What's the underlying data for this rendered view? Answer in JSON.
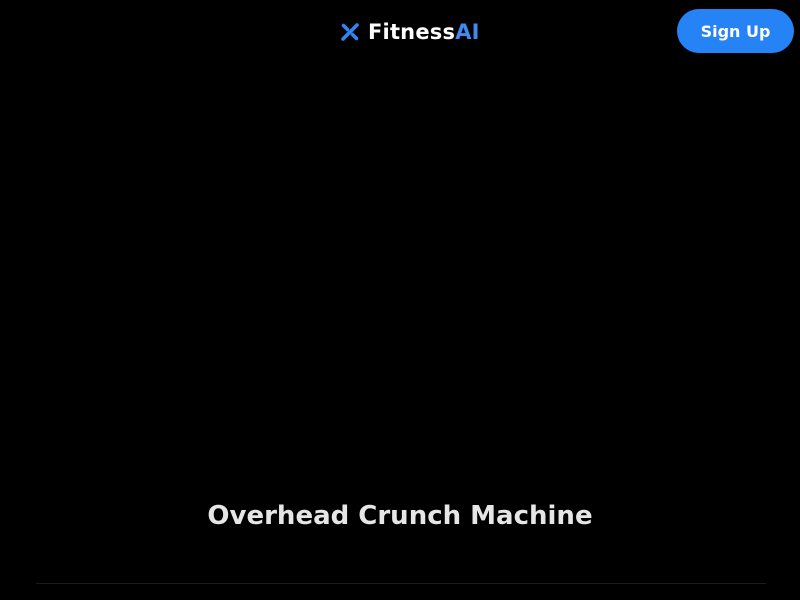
{
  "header": {
    "brand_main": "Fitness",
    "brand_accent": "AI",
    "signup_label": "Sign Up"
  },
  "main": {
    "exercise_title": "Overhead Crunch Machine"
  },
  "colors": {
    "background": "#000000",
    "accent": "#2583f6",
    "brand_accent": "#3d8bf0",
    "title_text": "#e6e6e6"
  },
  "icons": {
    "logo": "fitnessai-logo-icon"
  }
}
